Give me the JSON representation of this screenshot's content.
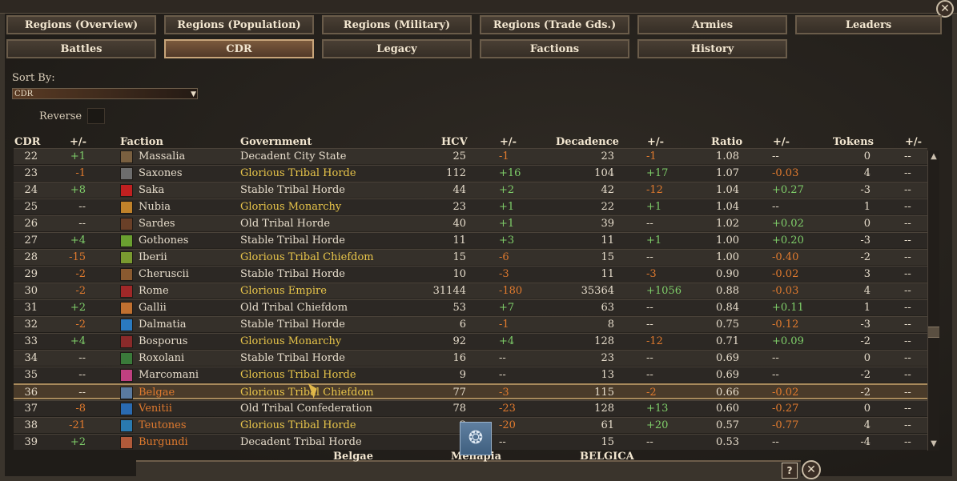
{
  "tabs": [
    {
      "label": "Regions (Overview)",
      "active": false
    },
    {
      "label": "Regions (Population)",
      "active": false
    },
    {
      "label": "Regions (Military)",
      "active": false
    },
    {
      "label": "Regions (Trade Gds.)",
      "active": false
    },
    {
      "label": "Armies",
      "active": false
    },
    {
      "label": "Leaders",
      "active": false
    },
    {
      "label": "Battles",
      "active": false
    },
    {
      "label": "CDR",
      "active": true
    },
    {
      "label": "Legacy",
      "active": false
    },
    {
      "label": "Factions",
      "active": false
    },
    {
      "label": "History",
      "active": false
    }
  ],
  "sort": {
    "label": "Sort By:",
    "value": "CDR",
    "reverse_label": "Reverse"
  },
  "headers": {
    "cdr": "CDR",
    "cdr_delta": "+/-",
    "faction": "Faction",
    "government": "Government",
    "hcv": "HCV",
    "hcv_delta": "+/-",
    "decadence": "Decadence",
    "dec_delta": "+/-",
    "ratio": "Ratio",
    "ratio_delta": "+/-",
    "tokens": "Tokens",
    "tok_delta": "+/-"
  },
  "colors": {
    "white": "#e6dccb",
    "yellow": "#e8c54a",
    "orange": "#e07a2e",
    "green": "#7fcf6a"
  },
  "rows": [
    {
      "cdr": "22",
      "cdrd": "+1",
      "faction": "Massalia",
      "fc": "white",
      "icon": "#7a6040",
      "gov": "Decadent City State",
      "gc": "white",
      "hcv": "25",
      "hcvd": "-1",
      "dec": "23",
      "decd": "-1",
      "ratio": "1.08",
      "ratiod": "--",
      "tok": "0",
      "tokd": "--"
    },
    {
      "cdr": "23",
      "cdrd": "-1",
      "faction": "Saxones",
      "fc": "white",
      "icon": "#6d6d6d",
      "gov": "Glorious Tribal Horde",
      "gc": "yellow",
      "hcv": "112",
      "hcvd": "+16",
      "dec": "104",
      "decd": "+17",
      "ratio": "1.07",
      "ratiod": "-0.03",
      "tok": "4",
      "tokd": "--"
    },
    {
      "cdr": "24",
      "cdrd": "+8",
      "faction": "Saka",
      "fc": "white",
      "icon": "#c02020",
      "gov": "Stable Tribal Horde",
      "gc": "white",
      "hcv": "44",
      "hcvd": "+2",
      "dec": "42",
      "decd": "-12",
      "ratio": "1.04",
      "ratiod": "+0.27",
      "tok": "-3",
      "tokd": "--"
    },
    {
      "cdr": "25",
      "cdrd": "--",
      "faction": "Nubia",
      "fc": "white",
      "icon": "#c0822a",
      "gov": "Glorious Monarchy",
      "gc": "yellow",
      "hcv": "23",
      "hcvd": "+1",
      "dec": "22",
      "decd": "+1",
      "ratio": "1.04",
      "ratiod": "--",
      "tok": "1",
      "tokd": "--"
    },
    {
      "cdr": "26",
      "cdrd": "--",
      "faction": "Sardes",
      "fc": "white",
      "icon": "#6a4028",
      "gov": "Old Tribal Horde",
      "gc": "white",
      "hcv": "40",
      "hcvd": "+1",
      "dec": "39",
      "decd": "--",
      "ratio": "1.02",
      "ratiod": "+0.02",
      "tok": "0",
      "tokd": "--"
    },
    {
      "cdr": "27",
      "cdrd": "+4",
      "faction": "Gothones",
      "fc": "white",
      "icon": "#6aa030",
      "gov": "Stable Tribal Horde",
      "gc": "white",
      "hcv": "11",
      "hcvd": "+3",
      "dec": "11",
      "decd": "+1",
      "ratio": "1.00",
      "ratiod": "+0.20",
      "tok": "-3",
      "tokd": "--"
    },
    {
      "cdr": "28",
      "cdrd": "-15",
      "faction": "Iberii",
      "fc": "white",
      "icon": "#7a9a30",
      "gov": "Glorious Tribal Chiefdom",
      "gc": "yellow",
      "hcv": "15",
      "hcvd": "-6",
      "dec": "15",
      "decd": "--",
      "ratio": "1.00",
      "ratiod": "-0.40",
      "tok": "-2",
      "tokd": "--"
    },
    {
      "cdr": "29",
      "cdrd": "-2",
      "faction": "Cheruscii",
      "fc": "white",
      "icon": "#8a5a30",
      "gov": "Stable Tribal Horde",
      "gc": "white",
      "hcv": "10",
      "hcvd": "-3",
      "dec": "11",
      "decd": "-3",
      "ratio": "0.90",
      "ratiod": "-0.02",
      "tok": "3",
      "tokd": "--"
    },
    {
      "cdr": "30",
      "cdrd": "-2",
      "faction": "Rome",
      "fc": "white",
      "icon": "#a02828",
      "gov": "Glorious Empire",
      "gc": "yellow",
      "hcv": "31144",
      "hcvd": "-180",
      "dec": "35364",
      "decd": "+1056",
      "ratio": "0.88",
      "ratiod": "-0.03",
      "tok": "4",
      "tokd": "--"
    },
    {
      "cdr": "31",
      "cdrd": "+2",
      "faction": "Gallii",
      "fc": "white",
      "icon": "#c07030",
      "gov": "Old Tribal Chiefdom",
      "gc": "white",
      "hcv": "53",
      "hcvd": "+7",
      "dec": "63",
      "decd": "--",
      "ratio": "0.84",
      "ratiod": "+0.11",
      "tok": "1",
      "tokd": "--"
    },
    {
      "cdr": "32",
      "cdrd": "-2",
      "faction": "Dalmatia",
      "fc": "white",
      "icon": "#2a7ac0",
      "gov": "Stable Tribal Horde",
      "gc": "white",
      "hcv": "6",
      "hcvd": "-1",
      "dec": "8",
      "decd": "--",
      "ratio": "0.75",
      "ratiod": "-0.12",
      "tok": "-3",
      "tokd": "--"
    },
    {
      "cdr": "33",
      "cdrd": "+4",
      "faction": "Bosporus",
      "fc": "white",
      "icon": "#8a2a2a",
      "gov": "Glorious Monarchy",
      "gc": "yellow",
      "hcv": "92",
      "hcvd": "+4",
      "dec": "128",
      "decd": "-12",
      "ratio": "0.71",
      "ratiod": "+0.09",
      "tok": "-2",
      "tokd": "--"
    },
    {
      "cdr": "34",
      "cdrd": "--",
      "faction": "Roxolani",
      "fc": "white",
      "icon": "#3a7a3a",
      "gov": "Stable Tribal Horde",
      "gc": "white",
      "hcv": "16",
      "hcvd": "--",
      "dec": "23",
      "decd": "--",
      "ratio": "0.69",
      "ratiod": "--",
      "tok": "0",
      "tokd": "--"
    },
    {
      "cdr": "35",
      "cdrd": "--",
      "faction": "Marcomani",
      "fc": "white",
      "icon": "#c04080",
      "gov": "Glorious Tribal Horde",
      "gc": "yellow",
      "hcv": "9",
      "hcvd": "--",
      "dec": "13",
      "decd": "--",
      "ratio": "0.69",
      "ratiod": "--",
      "tok": "-2",
      "tokd": "--"
    },
    {
      "cdr": "36",
      "cdrd": "--",
      "faction": "Belgae",
      "fc": "orange",
      "icon": "#5a7aa0",
      "gov": "Glorious Tribal Chiefdom",
      "gc": "yellow",
      "hcv": "77",
      "hcvd": "-3",
      "dec": "115",
      "decd": "-2",
      "ratio": "0.66",
      "ratiod": "-0.02",
      "tok": "-2",
      "tokd": "--",
      "selected": true
    },
    {
      "cdr": "37",
      "cdrd": "-8",
      "faction": "Venitii",
      "fc": "orange",
      "icon": "#2a6ab0",
      "gov": "Old Tribal Confederation",
      "gc": "white",
      "hcv": "78",
      "hcvd": "-23",
      "dec": "128",
      "decd": "+13",
      "ratio": "0.60",
      "ratiod": "-0.27",
      "tok": "0",
      "tokd": "--"
    },
    {
      "cdr": "38",
      "cdrd": "-21",
      "faction": "Teutones",
      "fc": "orange",
      "icon": "#2a7ab0",
      "gov": "Glorious Tribal Horde",
      "gc": "yellow",
      "hcv": "3",
      "hcvd": "-20",
      "dec": "61",
      "decd": "+20",
      "ratio": "0.57",
      "ratiod": "-0.77",
      "tok": "4",
      "tokd": "--"
    },
    {
      "cdr": "39",
      "cdrd": "+2",
      "faction": "Burgundi",
      "fc": "orange",
      "icon": "#b05a3a",
      "gov": "Decadent Tribal Horde",
      "gc": "white",
      "hcv": "",
      "hcvd": "--",
      "dec": "15",
      "decd": "--",
      "ratio": "0.53",
      "ratiod": "--",
      "tok": "-4",
      "tokd": "--"
    }
  ],
  "hover": {
    "faction": "Belgae",
    "neighbor": "Menapia",
    "region": "BELGICA"
  },
  "buttons": {
    "help": "?",
    "close": "✕"
  }
}
